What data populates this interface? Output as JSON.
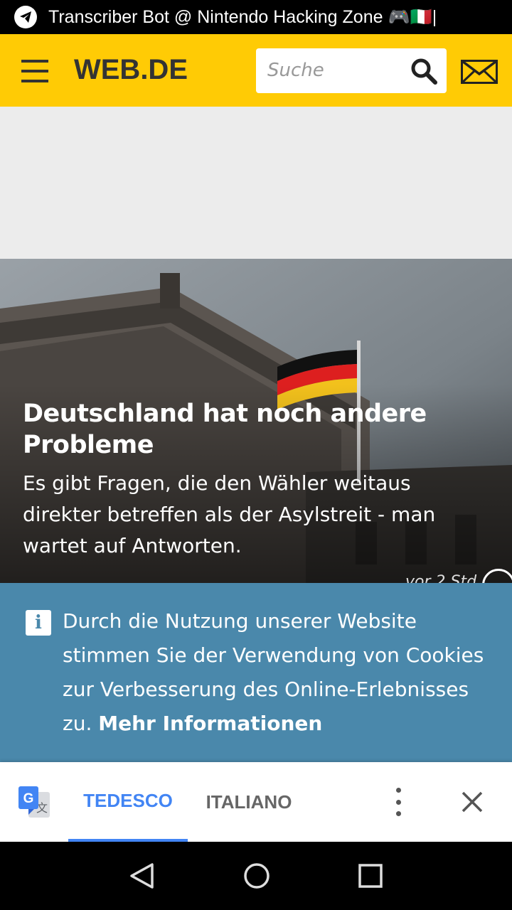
{
  "statusbar": {
    "ticker": "Transcriber Bot @ Nintendo Hacking Zone 🎮🇮🇹|"
  },
  "header": {
    "logo": "WEB.DE",
    "search_placeholder": "Suche",
    "brand_color": "#ffcb05"
  },
  "hero": {
    "headline": "Deutschland hat noch andere Probleme",
    "teaser": "Es gibt Fragen, die den Wähler weitaus direkter betreffen als der Asylstreit - man wartet auf Antworten.",
    "time": "vor 2 Std."
  },
  "cookie": {
    "text": "Durch die Nutzung unserer Website stimmen Sie der Verwendung von Cookies zur Verbesserung des Online-Erlebnisses zu.",
    "link": "Mehr Informationen",
    "bg_color": "#4a88ab"
  },
  "translate": {
    "source_lang": "TEDESCO",
    "target_lang": "ITALIANO",
    "accent_color": "#4285f4"
  },
  "icons": [
    "telegram-icon",
    "menu-icon",
    "search-icon",
    "mail-icon",
    "info-icon",
    "google-translate-icon",
    "more-icon",
    "close-icon",
    "back-icon",
    "home-icon",
    "recents-icon"
  ]
}
